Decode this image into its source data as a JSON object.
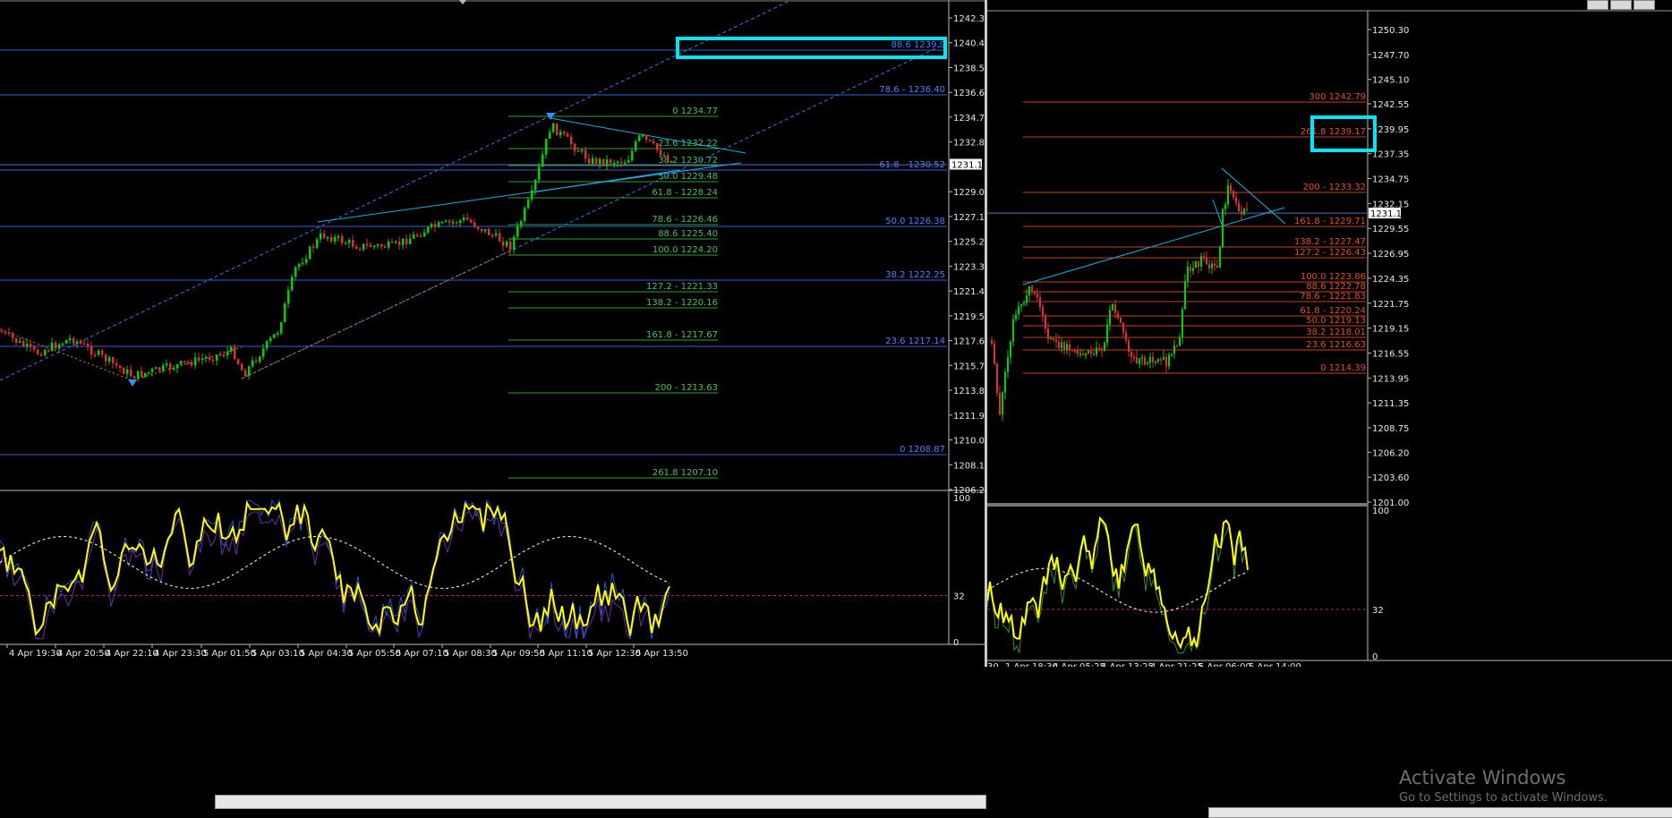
{
  "left_chart": {
    "price_ticks": [
      "1242.35",
      "1240.45",
      "1238.55",
      "1236.65",
      "1234.75",
      "1232.85",
      "1231.15",
      "1229.05",
      "1227.15",
      "1225.25",
      "1223.35",
      "1221.45",
      "1219.55",
      "1217.65",
      "1215.75",
      "1213.85",
      "1211.95",
      "1210.05",
      "1208.15",
      "1206.25"
    ],
    "current_price": "1231.15",
    "blue_fib_labels": [
      "88.6 1239.9",
      "78.6 - 1236.40",
      "61.8 - 1230.52",
      "50.0 1226.38",
      "38.2 1222.25",
      "23.6 1217.14",
      "0 1208.87"
    ],
    "green_fib_labels": [
      "0 1234.77",
      "23.6 1232.22",
      "38.2 1230.72",
      "50.0 1229.48",
      "61.8 - 1228.24",
      "78.6 - 1226.46",
      "88.6 1225.40",
      "100.0 1224.20",
      "127.2 - 1221.33",
      "138.2 - 1220.16",
      "161.8 - 1217.67",
      "200 - 1213.63",
      "261.8 1207.10"
    ],
    "time_labels": [
      "4 Apr 19:30",
      "4 Apr 20:50",
      "4 Apr 22:10",
      "4 Apr 23:30",
      "5 Apr 01:50",
      "5 Apr 03:10",
      "5 Apr 04:30",
      "5 Apr 05:50",
      "5 Apr 07:10",
      "5 Apr 08:30",
      "5 Apr 09:50",
      "5 Apr 11:10",
      "5 Apr 12:30",
      "5 Apr 13:50"
    ],
    "osc_ticks": [
      "100",
      "32",
      "0"
    ]
  },
  "right_chart": {
    "price_ticks": [
      "1250.30",
      "1247.70",
      "1245.10",
      "1242.55",
      "1239.95",
      "1237.35",
      "1234.75",
      "1232.15",
      "1229.55",
      "1226.95",
      "1224.35",
      "1221.75",
      "1219.15",
      "1216.55",
      "1213.95",
      "1211.35",
      "1208.75",
      "1206.20",
      "1203.60",
      "1201.00"
    ],
    "current_price": "1231.15",
    "red_fib_labels": [
      "300 1242.79",
      "261.8 1239.17",
      "200 - 1233.32",
      "161.8 - 1229.71",
      "138.2 - 1227.47",
      "127.2 - 1226.43",
      "100.0 1223.86",
      "88.6 1222.78",
      "78.6 - 1221.83",
      "61.8 - 1220.24",
      "50.0 1219.13",
      "38.2 1218.01",
      "23.6 1216.63",
      "0 1214.39"
    ],
    "time_labels": [
      "30",
      "1 Apr 18:30",
      "4 Apr 05:25",
      "4 Apr 13:25",
      "4 Apr 21:25",
      "5 Apr 06:00",
      "5 Apr 14:00"
    ],
    "osc_ticks": [
      "100",
      "32",
      "0"
    ]
  },
  "watermark": {
    "line1": "Activate Windows",
    "line2": "Go to Settings to activate Windows."
  },
  "colors": {
    "background": "#000000",
    "bull_candle": "#00d000",
    "bear_candle": "#e03030",
    "blue_fib": "#3a5bd9",
    "green_fib": "#2e9e3e",
    "red_fib": "#c8401f",
    "highlight_box": "#00e5f5",
    "stoch_main": "#ffff00",
    "trendline": "#1eaee0"
  }
}
